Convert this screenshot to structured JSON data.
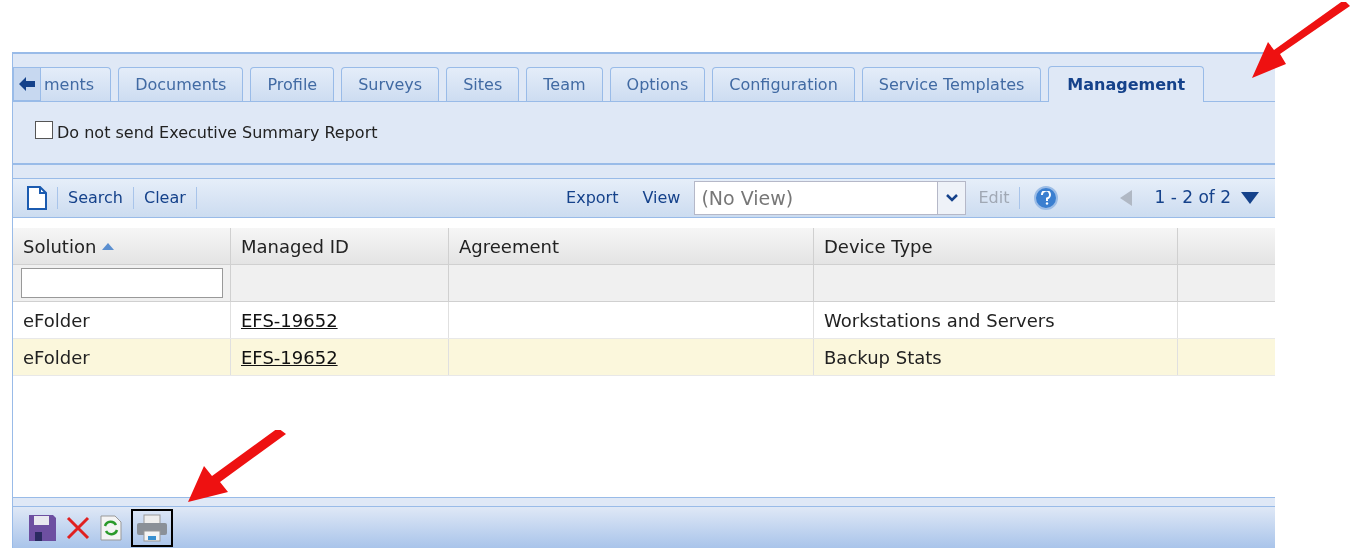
{
  "tabs": [
    {
      "label": "ments",
      "selected": false
    },
    {
      "label": "Documents",
      "selected": false
    },
    {
      "label": "Profile",
      "selected": false
    },
    {
      "label": "Surveys",
      "selected": false
    },
    {
      "label": "Sites",
      "selected": false
    },
    {
      "label": "Team",
      "selected": false
    },
    {
      "label": "Options",
      "selected": false
    },
    {
      "label": "Configuration",
      "selected": false
    },
    {
      "label": "Service Templates",
      "selected": false
    },
    {
      "label": "Management",
      "selected": true
    }
  ],
  "option": {
    "label": "Do not send Executive Summary Report",
    "checked": false
  },
  "toolbar": {
    "left": [
      "Search",
      "Clear"
    ],
    "export": "Export",
    "view_label": "View",
    "view_value": "(No View)",
    "edit": {
      "label": "Edit",
      "disabled": true
    },
    "pager": "1 - 2 of 2"
  },
  "table": {
    "columns": [
      {
        "label": "Solution",
        "sorted": true
      },
      {
        "label": "Managed ID",
        "sorted": false
      },
      {
        "label": "Agreement",
        "sorted": false
      },
      {
        "label": "Device Type",
        "sorted": false
      }
    ],
    "rows": [
      {
        "selected": false,
        "cells": [
          "eFolder",
          "EFS-19652",
          "",
          "Workstations and Servers"
        ]
      },
      {
        "selected": true,
        "cells": [
          "eFolder",
          "EFS-19652",
          "",
          "Backup Stats"
        ]
      }
    ]
  }
}
